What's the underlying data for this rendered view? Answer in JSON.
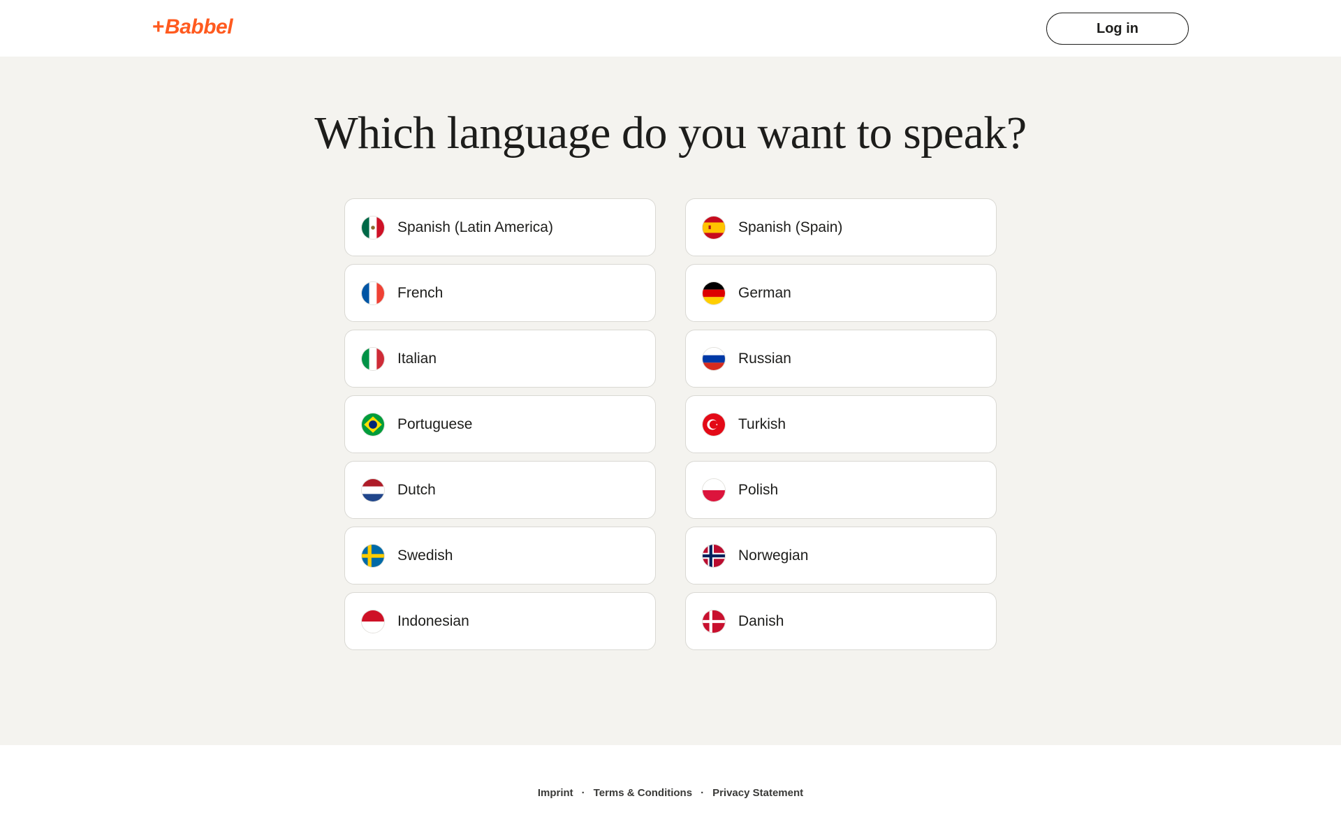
{
  "header": {
    "logo_plus": "+",
    "logo_text": "Babbel",
    "login_label": "Log in"
  },
  "main": {
    "title": "Which language do you want to speak?"
  },
  "languages": [
    {
      "label": "Spanish (Latin America)",
      "flag": "mexico-flag-icon"
    },
    {
      "label": "Spanish (Spain)",
      "flag": "spain-flag-icon"
    },
    {
      "label": "French",
      "flag": "france-flag-icon"
    },
    {
      "label": "German",
      "flag": "germany-flag-icon"
    },
    {
      "label": "Italian",
      "flag": "italy-flag-icon"
    },
    {
      "label": "Russian",
      "flag": "russia-flag-icon"
    },
    {
      "label": "Portuguese",
      "flag": "brazil-flag-icon"
    },
    {
      "label": "Turkish",
      "flag": "turkey-flag-icon"
    },
    {
      "label": "Dutch",
      "flag": "netherlands-flag-icon"
    },
    {
      "label": "Polish",
      "flag": "poland-flag-icon"
    },
    {
      "label": "Swedish",
      "flag": "sweden-flag-icon"
    },
    {
      "label": "Norwegian",
      "flag": "norway-flag-icon"
    },
    {
      "label": "Indonesian",
      "flag": "indonesia-flag-icon"
    },
    {
      "label": "Danish",
      "flag": "denmark-flag-icon"
    }
  ],
  "footer": {
    "links": [
      "Imprint",
      "Terms & Conditions",
      "Privacy Statement"
    ],
    "separator": "·"
  },
  "colors": {
    "brand": "#ff5a1f",
    "background": "#f4f3ef",
    "card_border": "#d9d8d3",
    "text": "#1d1d1b"
  }
}
